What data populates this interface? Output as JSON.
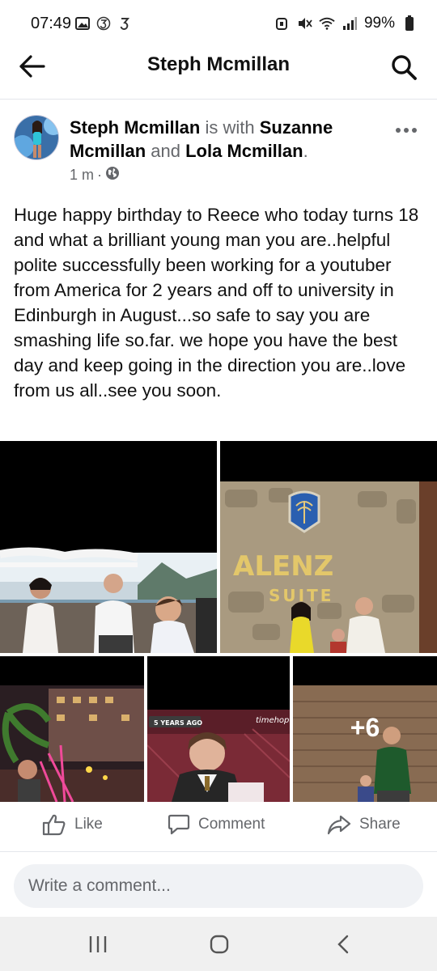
{
  "status_bar": {
    "time": "07:49",
    "battery": "99%"
  },
  "header": {
    "title": "Steph Mcmillan"
  },
  "post": {
    "author": "Steph Mcmillan",
    "with_word": "is with",
    "tagged_1": "Suzanne Mcmillan",
    "and_word": "and",
    "tagged_2": "Lola Mcmillan",
    "period": ".",
    "time_ago": "1 m",
    "separator": "·",
    "text": "Huge happy birthday to Reece who today turns 18 and what a brilliant young man you are..helpful polite successfully been working for a youtuber from America for 2 years and off to university in Edinburgh in August...so safe to say you are smashing life so.far. we hope you have the best day and keep going in the direction you are..love from us all..see you soon."
  },
  "photos": {
    "sign_text": "ALENZ",
    "sign_sub": "SUITE",
    "memory_tag": "5 YEARS AGO",
    "timehop_tag": "timehop",
    "more_count": "+6"
  },
  "actions": {
    "like": "Like",
    "comment": "Comment",
    "share": "Share"
  },
  "comment_box": {
    "placeholder": "Write a comment..."
  },
  "colors": {
    "muted_text": "#65676b",
    "divider": "#e4e6eb",
    "input_bg": "#f0f2f5"
  }
}
